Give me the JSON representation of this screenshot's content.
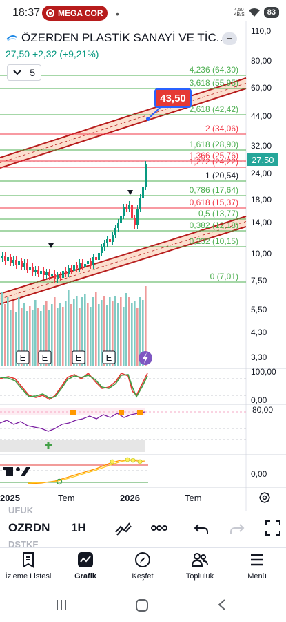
{
  "status_bar": {
    "time": "18:37",
    "recording_label": "MEGA COR",
    "dot": "•",
    "network": "4,50\nKB/S",
    "battery": "83"
  },
  "header": {
    "symbol_name": "ÖZERDEN PLASTİK SANAYİ VE TİC...",
    "price": "27,50",
    "change": "+2,32 (+9,21%)",
    "indicator_count": "5"
  },
  "colors": {
    "up": "#089981",
    "down": "#f23645",
    "fib_green": "#4caf50",
    "fib_red": "#f23645",
    "channel": "#b71c1c",
    "accent": "#2962ff"
  },
  "price_axis": {
    "labels": [
      "110,0",
      "80,00",
      "60,00",
      "44,00",
      "32,00",
      "24,00",
      "18,00",
      "14,00",
      "10,00",
      "7,50",
      "5,50",
      "4,30",
      "3,30"
    ],
    "current_price": "27,50"
  },
  "fib_levels": [
    {
      "label": "4,236 (64,30)",
      "color": "green"
    },
    {
      "label": "3,618 (55,95)",
      "color": "green"
    },
    {
      "label": "2,618 (42,42)",
      "color": "green"
    },
    {
      "label": "2 (34,06)",
      "color": "red"
    },
    {
      "label": "1,618 (28,90)",
      "color": "green"
    },
    {
      "label": "1,366 (25,76)",
      "color": "red"
    },
    {
      "label": "1,272 (24,22)",
      "color": "red"
    },
    {
      "label": "1 (20,54)",
      "color": "dark"
    },
    {
      "label": "0,786 (17,64)",
      "color": "green"
    },
    {
      "label": "0,618 (15,37)",
      "color": "red"
    },
    {
      "label": "0,5 (13,77)",
      "color": "green"
    },
    {
      "label": "0,382 (12,18)",
      "color": "green"
    },
    {
      "label": "0,232 (10,15)",
      "color": "green"
    },
    {
      "label": "0 (7,01)",
      "color": "green"
    }
  ],
  "target_label": "43,50",
  "earnings_markers": [
    "E",
    "E",
    "E",
    "E"
  ],
  "oscillator_axis": {
    "stoch_top": "100,00",
    "stoch_bottom": "0,00",
    "rsi_top": "80,00",
    "macd_zero": "0,00"
  },
  "time_axis": {
    "labels": [
      "2025",
      "Tem",
      "2026",
      "Tem"
    ]
  },
  "toolbar": {
    "ghost_top": "UFUK",
    "ghost_bottom": "DSTKF",
    "symbol": "OZRDN",
    "interval": "1H",
    "more": "ooo"
  },
  "bottom_nav": [
    {
      "label": "İzleme Listesi",
      "icon": "watchlist-icon"
    },
    {
      "label": "Grafik",
      "icon": "chart-icon"
    },
    {
      "label": "Keşfet",
      "icon": "compass-icon"
    },
    {
      "label": "Topluluk",
      "icon": "community-icon"
    },
    {
      "label": "Menü",
      "icon": "menu-icon"
    }
  ]
}
